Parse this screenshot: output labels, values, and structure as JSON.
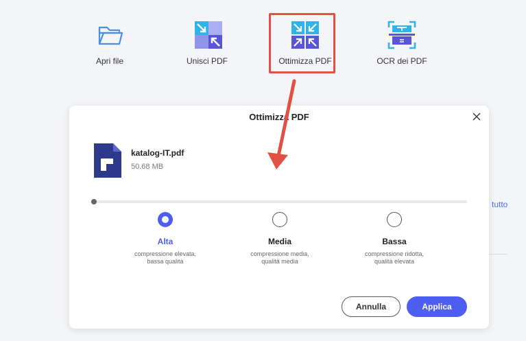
{
  "toolbar": {
    "open_label": "Apri file",
    "merge_label": "Unisci PDF",
    "optimize_label": "Ottimizza PDF",
    "ocr_label": "OCR dei PDF"
  },
  "background": {
    "side_text": "i tutto"
  },
  "dialog": {
    "title": "Ottimizza PDF",
    "file": {
      "name": "katalog-IT.pdf",
      "size": "50.68 MB"
    },
    "options": [
      {
        "label": "Alta",
        "desc1": "compressione elevata,",
        "desc2": "bassa qualità",
        "selected": true
      },
      {
        "label": "Media",
        "desc1": "compressione media,",
        "desc2": "qualità media",
        "selected": false
      },
      {
        "label": "Bassa",
        "desc1": "compressione ridotta,",
        "desc2": "qualità elevata",
        "selected": false
      }
    ],
    "cancel_label": "Annulla",
    "apply_label": "Applica"
  },
  "colors": {
    "accent": "#4e5ef0",
    "highlight": "#e05143",
    "folder": "#4a90e2"
  },
  "icons": {
    "open": "folder-icon",
    "merge": "merge-arrows-icon",
    "optimize": "compress-arrows-icon",
    "ocr": "ocr-scan-icon",
    "close": "close-icon",
    "file": "pdf-file-icon"
  }
}
